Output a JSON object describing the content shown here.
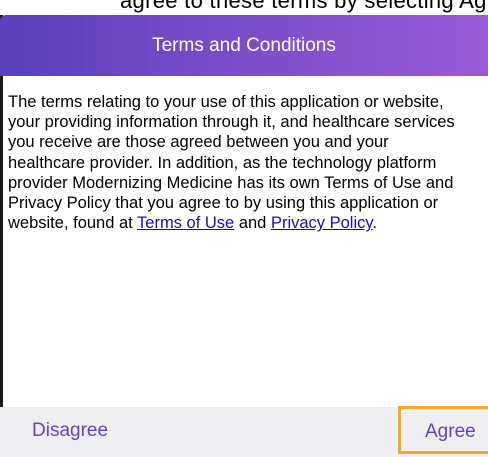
{
  "background_text": "agree to these terms by selecting Agree",
  "dialog": {
    "title": "Terms and Conditions",
    "body_lines": [
      "The terms relating to your use of this application or website,",
      "your providing information through it, and healthcare services",
      "you receive are those agreed between you and your",
      "healthcare provider. In addition, as the technology platform",
      "provider Modernizing Medicine has its own Terms of Use and",
      "Privacy Policy that you agree to by using this application or"
    ],
    "last_line_prefix": "website, found at ",
    "terms_link": "Terms of Use",
    "and_text": " and ",
    "privacy_link": "Privacy Policy",
    "last_line_suffix": ".",
    "disagree_label": "Disagree",
    "agree_label": "Agree"
  },
  "colors": {
    "header_gradient_start": "#5a40bd",
    "header_gradient_end": "#9a5bd8",
    "button_text": "#6a3fb8",
    "link": "#1a0dab",
    "focus_border": "#f5a623",
    "footer_bg": "#efeff2"
  }
}
